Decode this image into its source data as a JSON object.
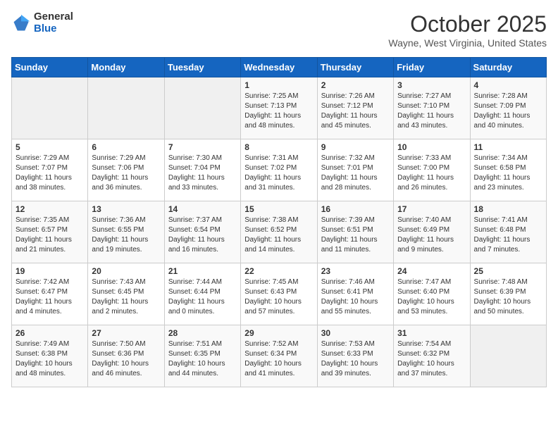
{
  "header": {
    "logo_general": "General",
    "logo_blue": "Blue",
    "title": "October 2025",
    "subtitle": "Wayne, West Virginia, United States"
  },
  "days_of_week": [
    "Sunday",
    "Monday",
    "Tuesday",
    "Wednesday",
    "Thursday",
    "Friday",
    "Saturday"
  ],
  "weeks": [
    [
      {
        "day": "",
        "empty": true
      },
      {
        "day": "",
        "empty": true
      },
      {
        "day": "",
        "empty": true
      },
      {
        "day": "1",
        "sunrise": "7:25 AM",
        "sunset": "7:13 PM",
        "daylight": "11 hours and 48 minutes."
      },
      {
        "day": "2",
        "sunrise": "7:26 AM",
        "sunset": "7:12 PM",
        "daylight": "11 hours and 45 minutes."
      },
      {
        "day": "3",
        "sunrise": "7:27 AM",
        "sunset": "7:10 PM",
        "daylight": "11 hours and 43 minutes."
      },
      {
        "day": "4",
        "sunrise": "7:28 AM",
        "sunset": "7:09 PM",
        "daylight": "11 hours and 40 minutes."
      }
    ],
    [
      {
        "day": "5",
        "sunrise": "7:29 AM",
        "sunset": "7:07 PM",
        "daylight": "11 hours and 38 minutes."
      },
      {
        "day": "6",
        "sunrise": "7:29 AM",
        "sunset": "7:06 PM",
        "daylight": "11 hours and 36 minutes."
      },
      {
        "day": "7",
        "sunrise": "7:30 AM",
        "sunset": "7:04 PM",
        "daylight": "11 hours and 33 minutes."
      },
      {
        "day": "8",
        "sunrise": "7:31 AM",
        "sunset": "7:02 PM",
        "daylight": "11 hours and 31 minutes."
      },
      {
        "day": "9",
        "sunrise": "7:32 AM",
        "sunset": "7:01 PM",
        "daylight": "11 hours and 28 minutes."
      },
      {
        "day": "10",
        "sunrise": "7:33 AM",
        "sunset": "7:00 PM",
        "daylight": "11 hours and 26 minutes."
      },
      {
        "day": "11",
        "sunrise": "7:34 AM",
        "sunset": "6:58 PM",
        "daylight": "11 hours and 23 minutes."
      }
    ],
    [
      {
        "day": "12",
        "sunrise": "7:35 AM",
        "sunset": "6:57 PM",
        "daylight": "11 hours and 21 minutes."
      },
      {
        "day": "13",
        "sunrise": "7:36 AM",
        "sunset": "6:55 PM",
        "daylight": "11 hours and 19 minutes."
      },
      {
        "day": "14",
        "sunrise": "7:37 AM",
        "sunset": "6:54 PM",
        "daylight": "11 hours and 16 minutes."
      },
      {
        "day": "15",
        "sunrise": "7:38 AM",
        "sunset": "6:52 PM",
        "daylight": "11 hours and 14 minutes."
      },
      {
        "day": "16",
        "sunrise": "7:39 AM",
        "sunset": "6:51 PM",
        "daylight": "11 hours and 11 minutes."
      },
      {
        "day": "17",
        "sunrise": "7:40 AM",
        "sunset": "6:49 PM",
        "daylight": "11 hours and 9 minutes."
      },
      {
        "day": "18",
        "sunrise": "7:41 AM",
        "sunset": "6:48 PM",
        "daylight": "11 hours and 7 minutes."
      }
    ],
    [
      {
        "day": "19",
        "sunrise": "7:42 AM",
        "sunset": "6:47 PM",
        "daylight": "11 hours and 4 minutes."
      },
      {
        "day": "20",
        "sunrise": "7:43 AM",
        "sunset": "6:45 PM",
        "daylight": "11 hours and 2 minutes."
      },
      {
        "day": "21",
        "sunrise": "7:44 AM",
        "sunset": "6:44 PM",
        "daylight": "11 hours and 0 minutes."
      },
      {
        "day": "22",
        "sunrise": "7:45 AM",
        "sunset": "6:43 PM",
        "daylight": "10 hours and 57 minutes."
      },
      {
        "day": "23",
        "sunrise": "7:46 AM",
        "sunset": "6:41 PM",
        "daylight": "10 hours and 55 minutes."
      },
      {
        "day": "24",
        "sunrise": "7:47 AM",
        "sunset": "6:40 PM",
        "daylight": "10 hours and 53 minutes."
      },
      {
        "day": "25",
        "sunrise": "7:48 AM",
        "sunset": "6:39 PM",
        "daylight": "10 hours and 50 minutes."
      }
    ],
    [
      {
        "day": "26",
        "sunrise": "7:49 AM",
        "sunset": "6:38 PM",
        "daylight": "10 hours and 48 minutes."
      },
      {
        "day": "27",
        "sunrise": "7:50 AM",
        "sunset": "6:36 PM",
        "daylight": "10 hours and 46 minutes."
      },
      {
        "day": "28",
        "sunrise": "7:51 AM",
        "sunset": "6:35 PM",
        "daylight": "10 hours and 44 minutes."
      },
      {
        "day": "29",
        "sunrise": "7:52 AM",
        "sunset": "6:34 PM",
        "daylight": "10 hours and 41 minutes."
      },
      {
        "day": "30",
        "sunrise": "7:53 AM",
        "sunset": "6:33 PM",
        "daylight": "10 hours and 39 minutes."
      },
      {
        "day": "31",
        "sunrise": "7:54 AM",
        "sunset": "6:32 PM",
        "daylight": "10 hours and 37 minutes."
      },
      {
        "day": "",
        "empty": true
      }
    ]
  ],
  "labels": {
    "sunrise_prefix": "Sunrise: ",
    "sunset_prefix": "Sunset: ",
    "daylight_prefix": "Daylight: "
  }
}
